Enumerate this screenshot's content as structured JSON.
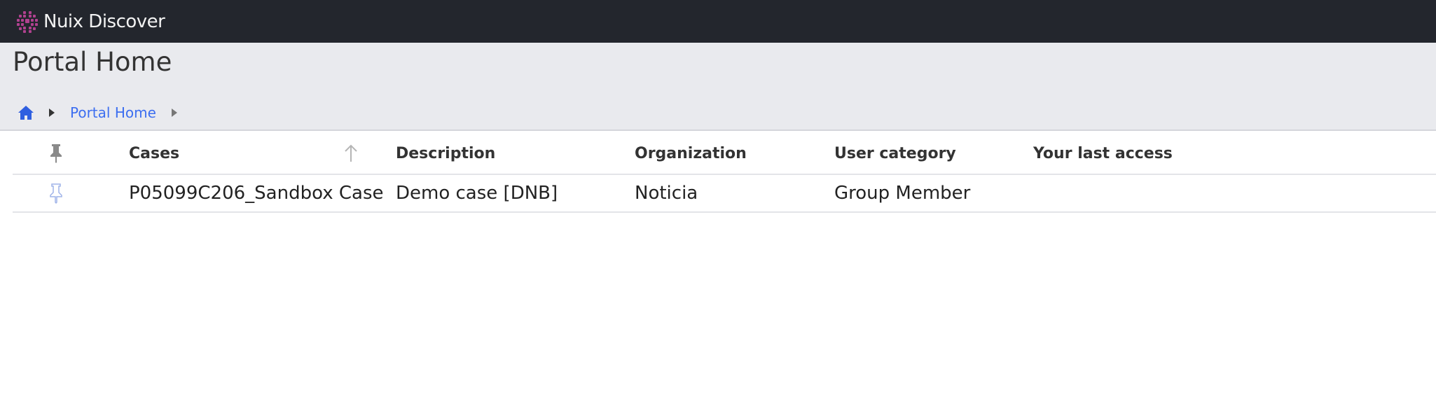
{
  "app": {
    "name": "Nuix Discover"
  },
  "page": {
    "title": "Portal Home"
  },
  "breadcrumb": {
    "items": [
      {
        "label": "Portal Home"
      }
    ]
  },
  "table": {
    "columns": [
      {
        "label": "Cases",
        "sort": "ascending"
      },
      {
        "label": "Description"
      },
      {
        "label": "Organization"
      },
      {
        "label": "User category"
      },
      {
        "label": "Your last access"
      }
    ],
    "rows": [
      {
        "pinned": false,
        "case": "P05099C206_Sandbox Case",
        "description": "Demo case [DNB]",
        "organization": "Noticia",
        "user_category": "Group Member",
        "last_access": ""
      }
    ]
  },
  "icons": {
    "logo": "nuix-logo-icon",
    "home": "home-icon",
    "pin_header": "pin-icon",
    "pin_row": "pin-outline-icon",
    "sort": "arrow-up-icon"
  },
  "colors": {
    "topbar": "#23262d",
    "header_band": "#e9eaee",
    "link": "#3c6ef0",
    "logo_accent": "#b0418f"
  }
}
